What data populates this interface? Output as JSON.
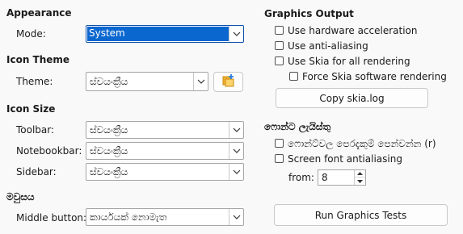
{
  "appearance": {
    "heading": "Appearance",
    "mode_label": "Mode:",
    "mode_value": "System"
  },
  "icon_theme": {
    "heading": "Icon Theme",
    "theme_label": "Theme:",
    "theme_value": "ස්වයංක්‍රීය",
    "extension_button_icon": "add-extension-icon"
  },
  "icon_size": {
    "heading": "Icon Size",
    "toolbar_label": "Toolbar:",
    "toolbar_value": "ස්වයංක්‍රීය",
    "notebookbar_label": "Notebookbar:",
    "notebookbar_value": "ස්වයංක්‍රීය",
    "sidebar_label": "Sidebar:",
    "sidebar_value": "ස්වයංක්‍රීය"
  },
  "mouse": {
    "heading": "මවුසය",
    "middle_button_label": "Middle button:",
    "middle_button_value": "කාර්යයක් නොමැත"
  },
  "graphics_output": {
    "heading": "Graphics Output",
    "hw_accel_label": "Use hardware acceleration",
    "hw_accel_checked": false,
    "antialias_label": "Use anti-aliasing",
    "antialias_checked": false,
    "skia_label": "Use Skia for all rendering",
    "skia_checked": false,
    "force_skia_label": "Force Skia software rendering",
    "force_skia_checked": false,
    "copy_skia_label": "Copy skia.log"
  },
  "font_lists": {
    "heading": "ෆොන්ට ලැයිස්තු",
    "preview_label": "ෆොන්ට්වල පෙරදැකුම් පෙන්වන්න (r)",
    "preview_checked": false,
    "screen_aa_label": "Screen font antialiasing",
    "screen_aa_checked": false,
    "from_label": "from:",
    "from_value": "8"
  },
  "run_tests_label": "Run Graphics Tests",
  "colors": {
    "accent": "#0b67d0",
    "background": "#f9f9f9"
  }
}
